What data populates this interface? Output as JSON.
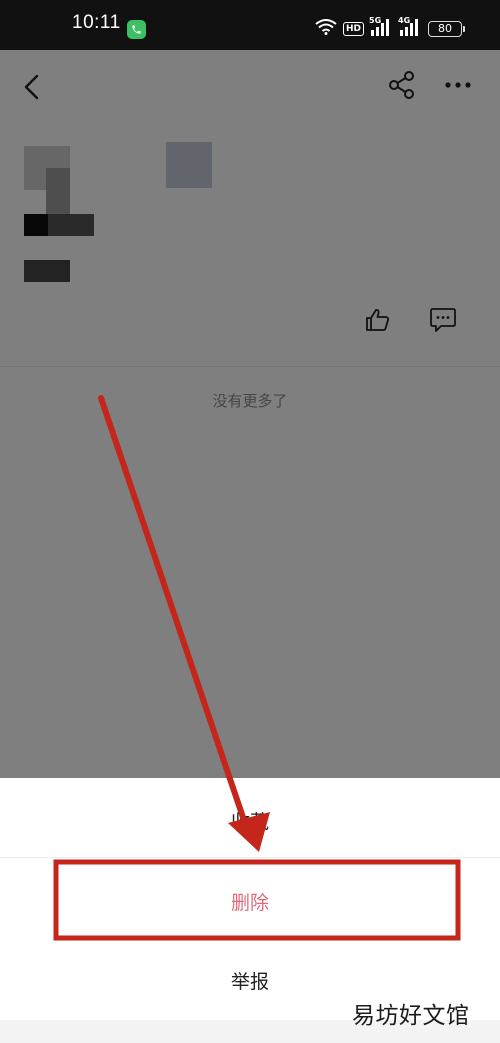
{
  "status_bar": {
    "time": "10:11",
    "hd": "HD",
    "net_5g": "5G",
    "net_4g": "4G",
    "battery": "80",
    "icons": [
      "call-icon",
      "wifi-icon",
      "signal-icon",
      "battery-icon"
    ]
  },
  "toolbar": {
    "icons": [
      "back-icon",
      "share-icon",
      "more-icon"
    ]
  },
  "post": {
    "actions": [
      "like-icon",
      "comment-icon"
    ]
  },
  "footer_text": "没有更多了",
  "action_sheet": {
    "items": [
      {
        "label": "收藏"
      },
      {
        "label": "删除"
      },
      {
        "label": "举报"
      }
    ]
  },
  "annotation": {
    "arrow_color": "#c4261b",
    "box_color": "#c4261b"
  },
  "watermark": "易坊好文馆",
  "colors": {
    "delete": "#e26a7a",
    "overlay": "rgba(0,0,0,0.5)"
  }
}
